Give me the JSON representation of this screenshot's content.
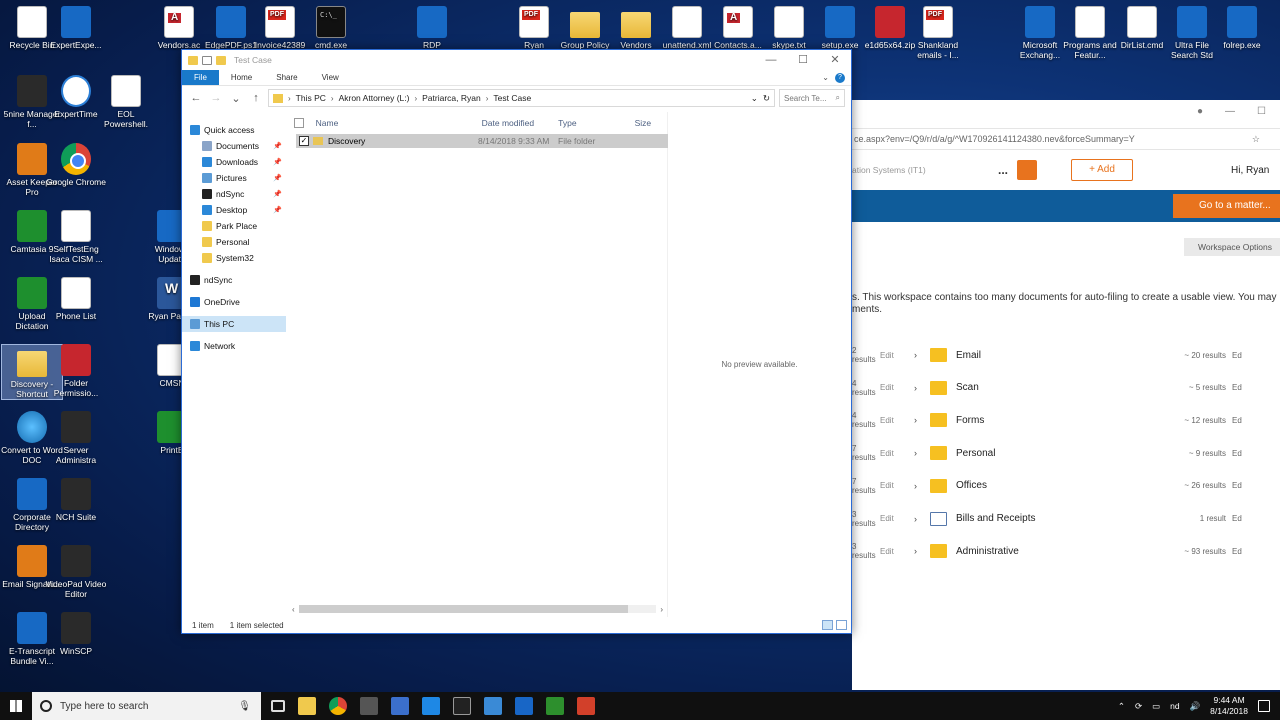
{
  "desktop_icons": [
    {
      "label": "Recycle Bin",
      "icon": "recycle-bin-icon"
    },
    {
      "label": "ExpertExpe...",
      "icon": "expert-expense-icon"
    },
    {
      "label": "Vendors.ac",
      "icon": "access-file-icon"
    },
    {
      "label": "EdgePDF.ps1",
      "icon": "powershell-file-icon"
    },
    {
      "label": "Invoice42389",
      "icon": "pdf-file-icon"
    },
    {
      "label": "cmd.exe",
      "icon": "cmd-icon"
    },
    {
      "label": "RDP",
      "icon": "rdp-icon"
    },
    {
      "label": "Ryan",
      "icon": "pdf-file-icon"
    },
    {
      "label": "Group Policy",
      "icon": "group-policy-icon"
    },
    {
      "label": "Vendors",
      "icon": "folder-icon"
    },
    {
      "label": "unattend.xml",
      "icon": "file-icon"
    },
    {
      "label": "Contacts.a...",
      "icon": "access-file-icon"
    },
    {
      "label": "skype.txt",
      "icon": "text-file-icon"
    },
    {
      "label": "setup.exe",
      "icon": "setup-icon"
    },
    {
      "label": "e1d65x64.zip",
      "icon": "zip-icon"
    },
    {
      "label": "Shankland emails - I...",
      "icon": "pdf-file-icon"
    },
    {
      "label": "Microsoft Exchang...",
      "icon": "exchange-icon"
    },
    {
      "label": "Programs and Featur...",
      "icon": "programs-icon"
    },
    {
      "label": "DirList.cmd",
      "icon": "cmd-file-icon"
    },
    {
      "label": "Ultra File Search Std",
      "icon": "search-app-icon"
    },
    {
      "label": "folrep.exe",
      "icon": "folrep-icon"
    },
    {
      "label": "5nine Manager f...",
      "icon": "5nine-icon"
    },
    {
      "label": "ExpertTime",
      "icon": "clock-icon"
    },
    {
      "label": "EOL Powershell.",
      "icon": "file-icon"
    },
    {
      "label": "Asset Keeper Pro",
      "icon": "asset-keeper-icon"
    },
    {
      "label": "Google Chrome",
      "icon": "chrome-icon"
    },
    {
      "label": "Camtasia 9",
      "icon": "camtasia-icon"
    },
    {
      "label": "SelfTestEng Isaca CISM ...",
      "icon": "selftest-icon"
    },
    {
      "label": "Windows Update",
      "icon": "windows-icon"
    },
    {
      "label": "Upload Dictation",
      "icon": "upload-icon"
    },
    {
      "label": "Phone List",
      "icon": "file-icon"
    },
    {
      "label": "Ryan Patriar",
      "icon": "word-icon"
    },
    {
      "label": "Discovery - Shortcut",
      "icon": "folder-icon"
    },
    {
      "label": "Folder Permissio...",
      "icon": "fpm-icon"
    },
    {
      "label": "CMSN",
      "icon": "cmsn-icon"
    },
    {
      "label": "Convert to Word DOC",
      "icon": "globe-icon"
    },
    {
      "label": "Server Administra",
      "icon": "server-icon"
    },
    {
      "label": "PrintE",
      "icon": "print-icon"
    },
    {
      "label": "Corporate Directory",
      "icon": "directory-icon"
    },
    {
      "label": "NCH Suite",
      "icon": "nch-icon"
    },
    {
      "label": "Email Signatu...",
      "icon": "email-sig-icon"
    },
    {
      "label": "VideoPad Video Editor",
      "icon": "videopad-icon"
    },
    {
      "label": "E-Transcript Bundle Vi...",
      "icon": "transcript-icon"
    },
    {
      "label": "WinSCP",
      "icon": "winscp-icon"
    }
  ],
  "explorer": {
    "title": "Test Case",
    "ribbon_tabs": [
      "File",
      "Home",
      "Share",
      "View"
    ],
    "breadcrumbs": [
      "This PC",
      "Akron Attorney (L:)",
      "Patriarca, Ryan",
      "Test Case"
    ],
    "search_placeholder": "Search Te...",
    "nav_items": [
      {
        "label": "Quick access",
        "icon": "star-icon",
        "sub": false,
        "pinned": false
      },
      {
        "label": "Documents",
        "icon": "documents-icon",
        "sub": true,
        "pinned": true
      },
      {
        "label": "Downloads",
        "icon": "downloads-icon",
        "sub": true,
        "pinned": true
      },
      {
        "label": "Pictures",
        "icon": "pictures-icon",
        "sub": true,
        "pinned": true
      },
      {
        "label": "ndSync",
        "icon": "ndsync-icon",
        "sub": true,
        "pinned": true
      },
      {
        "label": "Desktop",
        "icon": "desktop-icon",
        "sub": true,
        "pinned": true
      },
      {
        "label": "Park Place",
        "icon": "folder-icon",
        "sub": true,
        "pinned": false
      },
      {
        "label": "Personal",
        "icon": "folder-icon",
        "sub": true,
        "pinned": false
      },
      {
        "label": "System32",
        "icon": "folder-icon",
        "sub": true,
        "pinned": false
      },
      {
        "label": "ndSync",
        "icon": "ndsync-icon",
        "sub": false,
        "pinned": false
      },
      {
        "label": "OneDrive",
        "icon": "onedrive-icon",
        "sub": false,
        "pinned": false
      },
      {
        "label": "This PC",
        "icon": "pc-icon",
        "sub": false,
        "pinned": false
      },
      {
        "label": "Network",
        "icon": "network-icon",
        "sub": false,
        "pinned": false
      }
    ],
    "columns": [
      "Name",
      "Date modified",
      "Type",
      "Size"
    ],
    "rows": [
      {
        "name": "Discovery",
        "date": "8/14/2018 9:33 AM",
        "type": "File folder",
        "size": ""
      }
    ],
    "preview_text": "No preview available.",
    "status_count": "1 item",
    "status_selected": "1 item selected"
  },
  "browser": {
    "url": "ce.aspx?env=/Q9/r/d/a/g/^W170926141124380.nev&forceSummary=Y",
    "cabinet": "ation Systems (IT1)",
    "more": "...",
    "add_label": "+ Add",
    "greeting": "Hi,  Ryan",
    "goto_label": "Go to a matter...",
    "workspace_options": "Workspace Options",
    "message_line1": "s. This workspace contains too many documents for auto-filing to create a usable view. You may",
    "message_line2": "ments.",
    "workspace_rows": [
      {
        "left_results": "2 results",
        "name": "Email",
        "count": "~ 20 results",
        "icon": "folder"
      },
      {
        "left_results": "4 results",
        "name": "Scan",
        "count": "~ 5 results",
        "icon": "folder"
      },
      {
        "left_results": "4 results",
        "name": "Forms",
        "count": "~ 12 results",
        "icon": "folder"
      },
      {
        "left_results": "7 results",
        "name": "Personal",
        "count": "~ 9 results",
        "icon": "folder"
      },
      {
        "left_results": "7 results",
        "name": "Offices",
        "count": "~ 26 results",
        "icon": "folder"
      },
      {
        "left_results": "3 results",
        "name": "Bills and Receipts",
        "count": "1 result",
        "icon": "bill"
      },
      {
        "left_results": "3 results",
        "name": "Administrative",
        "count": "~ 93 results",
        "icon": "folder"
      }
    ],
    "edit_label": "Edit",
    "edit_short": "Ed"
  },
  "taskbar": {
    "search_placeholder": "Type here to search",
    "tray_label": "nd",
    "time": "9:44 AM",
    "date": "8/14/2018"
  }
}
